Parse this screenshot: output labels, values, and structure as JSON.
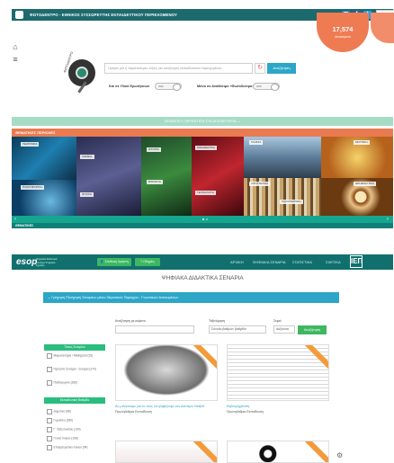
{
  "header": {
    "title": "ΦΩΤΟΔΕΝΤΡΟ - ΕΘΝΙΚΟΣ ΣΥΣΣΩΡΕΥΤΗΣ ΕΚΠΑΙΔΕΥΤΙΚΟΥ ΠΕΡΙΕΧΟΜΕΝΟΥ",
    "social": [
      "email-icon",
      "facebook-icon",
      "twitter-icon"
    ],
    "language": "Ελληνικά",
    "counter_value": "17,574",
    "counter_label": "Αντικείμενα"
  },
  "search": {
    "placeholder": "Γράψτε μία ή περισσότερες λέξεις για αναζήτηση εκπαιδευτικού περιεχομένου",
    "button": "Αναζήτηση",
    "lens_label": "ΦΩΤΟΔΕΝΤΡΟ",
    "filter1_label": "Και σε Υλικό Ερωτήσεων",
    "filter1_state": "OFF",
    "filter2_label": "Μόνο σε Αναθέσιμο «Φωτόδεντρο»",
    "filter2_state": "OFF"
  },
  "thematic": {
    "green_band": "ΘΕΜΑΤΙΚΗ ΠΕΡΙΗΓΗΣΗ ΣΤΑ ΑΠΟΘΕΤΗΡΙΑ",
    "orange_band": "ΘΕΜΑΤΙΚΕΣ ΠΕΡΙΟΧΕΣ",
    "tiles": [
      "ΓΕΩΓΡΑΦΙΑ",
      "ΠΛΗΡΟΦΟΡΙΚΗ",
      "ΧΗΜΕΙΑ",
      "ΦΥΣΙΚΗ",
      "ΙΣΤΟΡΙΑ",
      "ΒΙΟΛΟΓΙΑ",
      "ΜΑΘΗΜΑΤΙΚΑ",
      "ΤΕΧΝΟΛΟΓΙΑ",
      "ΓΛΩΣΣΑ",
      "ΛΟΓΟΤΕΧΝΙΑ",
      "ΚΑΛΛΙΤΕΧΝΙΚΑ",
      "ΜΟΥΣΙΚΗ",
      "ΘΡΗΣΚΕΥΤΙΚΑ",
      "ΑΓΓΛΙΚΑ"
    ],
    "nav_band": "ΘΕΜΑΤΙΚΕΣ",
    "accent_colors": {
      "green": "#a6dcc6",
      "orange": "#ea7a4f",
      "teal": "#15a68f"
    }
  },
  "esop": {
    "logo": "esop",
    "logo_sub": "Ψηφιακά Διδακτικά Σενάρια Ψηφιακό Σχολείο",
    "btn_login": "Σύνδεση Χρήστη",
    "btn_help": "Οδηγίες",
    "nav": [
      "ΑΡΧΙΚΗ",
      "ΨΗΦΙΑΚΑ ΣΕΝΑΡΙΑ",
      "ΣΤΑΤΙΣΤΙΚΑ",
      "ΣΧΕΤΙΚΑ"
    ],
    "iep": "ΙΕΠ",
    "page_title": "ΨΗΦΙΑΚΑ ΔΙΔΑΚΤΙΚΑ ΣΕΝΑΡΙΑ",
    "accordion": "Γρήγορη Πλοήγηση Σεναρίων μέσω Θεματικών Περιοχών - Γνωστικών Αντικειμένων",
    "form": {
      "keyword_label": "Αναζήτηση με κείμενο",
      "sort_label": "Ταξινόμηση",
      "sort_value": "Σύνολα βαθμών βαθμίδα",
      "order_label": "Σειρά",
      "order_value": "Αύξουσα",
      "search_button": "Αναζήτηση"
    },
    "filters": {
      "type_header": "Τύπος Σεναρίου",
      "type_items": [
        "Μικροσενάρια / Μαθήματα (32)",
        "Πρότυπα Σενάρια - Σενάρια (174)",
        "Παιδαγωγικό (266)"
      ],
      "level_header": "Εκπαιδευτική Βαθμίδα",
      "level_items": [
        "Δημοτικό (88)",
        "Γυμνάσιο (280)",
        "Γ΄ τάξη Λυκείου (130)",
        "Γενικό Λύκειο (198)",
        "Επαγγελματικό Λύκειο (94)"
      ]
    },
    "cards": [
      {
        "title": "Ας μιλήσουμε για το πώς να ψηφίζουμε τον Δεύτερο Ντάβιδ",
        "sub": "Πρωτοβάθμια Εκπαίδευση"
      },
      {
        "title": "Εκβιομηχάνιση",
        "sub": "Πρωτοβάθμια Εκπαίδευση"
      },
      {
        "title": "",
        "sub": ""
      },
      {
        "title": "",
        "sub": ""
      }
    ]
  }
}
